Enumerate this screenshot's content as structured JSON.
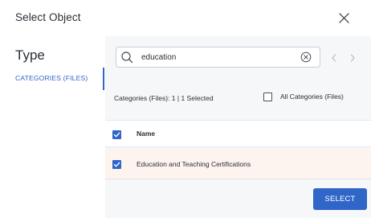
{
  "dialog": {
    "title": "Select Object",
    "close_icon": "close-icon"
  },
  "sidebar": {
    "heading": "Type",
    "items": [
      {
        "label": "CATEGORIES (FILES)",
        "active": true
      }
    ]
  },
  "search": {
    "value": "education",
    "placeholder": "",
    "search_icon": "search-icon",
    "clear_icon": "clear-circle-icon"
  },
  "pagination": {
    "prev_icon": "chevron-left-icon",
    "next_icon": "chevron-right-icon"
  },
  "summary": {
    "text": "Categories (Files): 1 | 1 Selected"
  },
  "filter": {
    "all_categories_label": "All Categories (Files)",
    "all_categories_checked": false
  },
  "grid": {
    "columns": [
      {
        "label": "Name"
      }
    ],
    "header_checked": true,
    "rows": [
      {
        "name": "Education and Teaching Certifications",
        "checked": true
      }
    ]
  },
  "actions": {
    "select_label": "SELECT"
  },
  "colors": {
    "accent": "#2f66c8",
    "selected_row": "#fdf3ef",
    "panel_bg": "#f6f7f9"
  }
}
